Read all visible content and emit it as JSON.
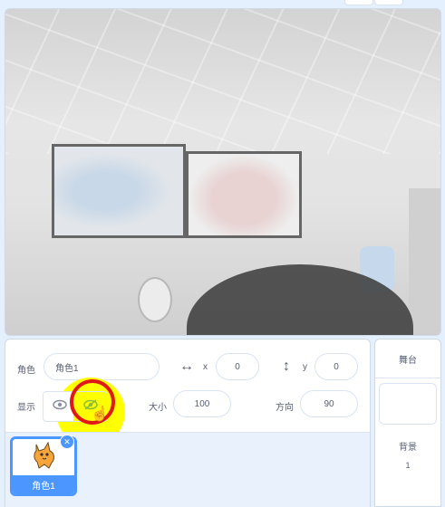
{
  "sprite_info": {
    "sprite_label": "角色",
    "sprite_name": "角色1",
    "x_label": "x",
    "x_value": "0",
    "y_label": "y",
    "y_value": "0",
    "show_label": "显示",
    "size_label": "大小",
    "size_value": "100",
    "direction_label": "方向",
    "direction_value": "90"
  },
  "sprite_list": [
    {
      "name": "角色1",
      "selected": true
    }
  ],
  "stage_panel": {
    "title": "舞台",
    "backdrops_label": "背景",
    "backdrops_count": "1"
  },
  "icons": {
    "x_arrow": "horizontal-arrows-icon",
    "y_arrow": "vertical-arrows-icon",
    "show": "eye-icon",
    "hide": "eye-slash-icon",
    "delete": "close-icon",
    "cursor": "hand-pointer-icon"
  },
  "colors": {
    "accent": "#4c97ff",
    "highlight": "#ffff00",
    "annotation_ring": "#e01818"
  }
}
